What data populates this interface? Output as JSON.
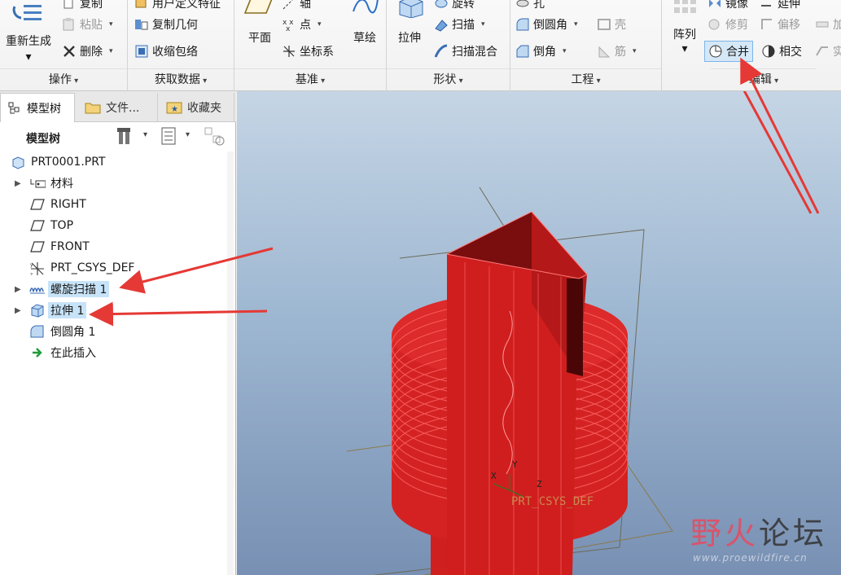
{
  "ribbon": {
    "groups": {
      "operations": {
        "label": "操作",
        "regenerate": "重新生成",
        "paste": "粘贴",
        "delete": "删除",
        "copy_partial": "复制"
      },
      "get_data": {
        "label": "获取数据",
        "copy_geometry": "复制几何",
        "shrinkwrap": "收缩包络",
        "user_feature_partial": "用户定义特征"
      },
      "datum": {
        "label": "基准",
        "plane": "平面",
        "point": "点",
        "csys": "坐标系",
        "sketch": "草绘",
        "axis_partial": "轴"
      },
      "shapes": {
        "label": "形状",
        "extrude": "拉伸",
        "sweep": "扫描",
        "swept_blend": "扫描混合",
        "revolve_partial": "旋转"
      },
      "engineering": {
        "label": "工程",
        "round": "倒圆角",
        "chamfer": "倒角",
        "shell": "壳",
        "rib": "筋",
        "hole_partial": "孔"
      },
      "editing": {
        "label": "编辑",
        "pattern": "阵列",
        "trim": "修剪",
        "offset": "偏移",
        "merge": "合并",
        "intersect": "相交",
        "thicken_partial": "加",
        "solidify_partial": "实",
        "mirror_partial": "镜像",
        "extend_partial": "延伸"
      }
    }
  },
  "left_panel": {
    "tabs": [
      "模型树",
      "文件...",
      "收藏夹"
    ],
    "tree_title": "模型树",
    "items": [
      {
        "label": "PRT0001.PRT",
        "icon": "part-icon",
        "expandable": false,
        "highlight": false,
        "root": true
      },
      {
        "label": "材料",
        "icon": "material-icon",
        "expandable": true,
        "highlight": false
      },
      {
        "label": "RIGHT",
        "icon": "datum-plane-icon",
        "expandable": false,
        "highlight": false
      },
      {
        "label": "TOP",
        "icon": "datum-plane-icon",
        "expandable": false,
        "highlight": false
      },
      {
        "label": "FRONT",
        "icon": "datum-plane-icon",
        "expandable": false,
        "highlight": false
      },
      {
        "label": "PRT_CSYS_DEF",
        "icon": "csys-icon",
        "expandable": false,
        "highlight": false
      },
      {
        "label": "螺旋扫描 1",
        "icon": "helical-sweep-icon",
        "expandable": true,
        "highlight": true
      },
      {
        "label": "拉伸 1",
        "icon": "extrude-icon",
        "expandable": true,
        "highlight": true
      },
      {
        "label": "倒圆角 1",
        "icon": "round-icon",
        "expandable": false,
        "highlight": false
      },
      {
        "label": "在此插入",
        "icon": "insert-here-icon",
        "expandable": false,
        "highlight": false
      }
    ]
  },
  "viewport": {
    "csys_label": "PRT_CSYS_DEF",
    "axis_x": "X",
    "axis_y": "Y",
    "axis_z": "Z",
    "watermark_main_1": "野",
    "watermark_main_2": "火",
    "watermark_main_3": "论坛",
    "watermark_url": "www.proewildfire.cn",
    "colors": {
      "model": "#d81e1e",
      "model_dark": "#7a0c0c",
      "datum": "#8a8a5a",
      "annotation_arrow": "#e53935"
    }
  }
}
